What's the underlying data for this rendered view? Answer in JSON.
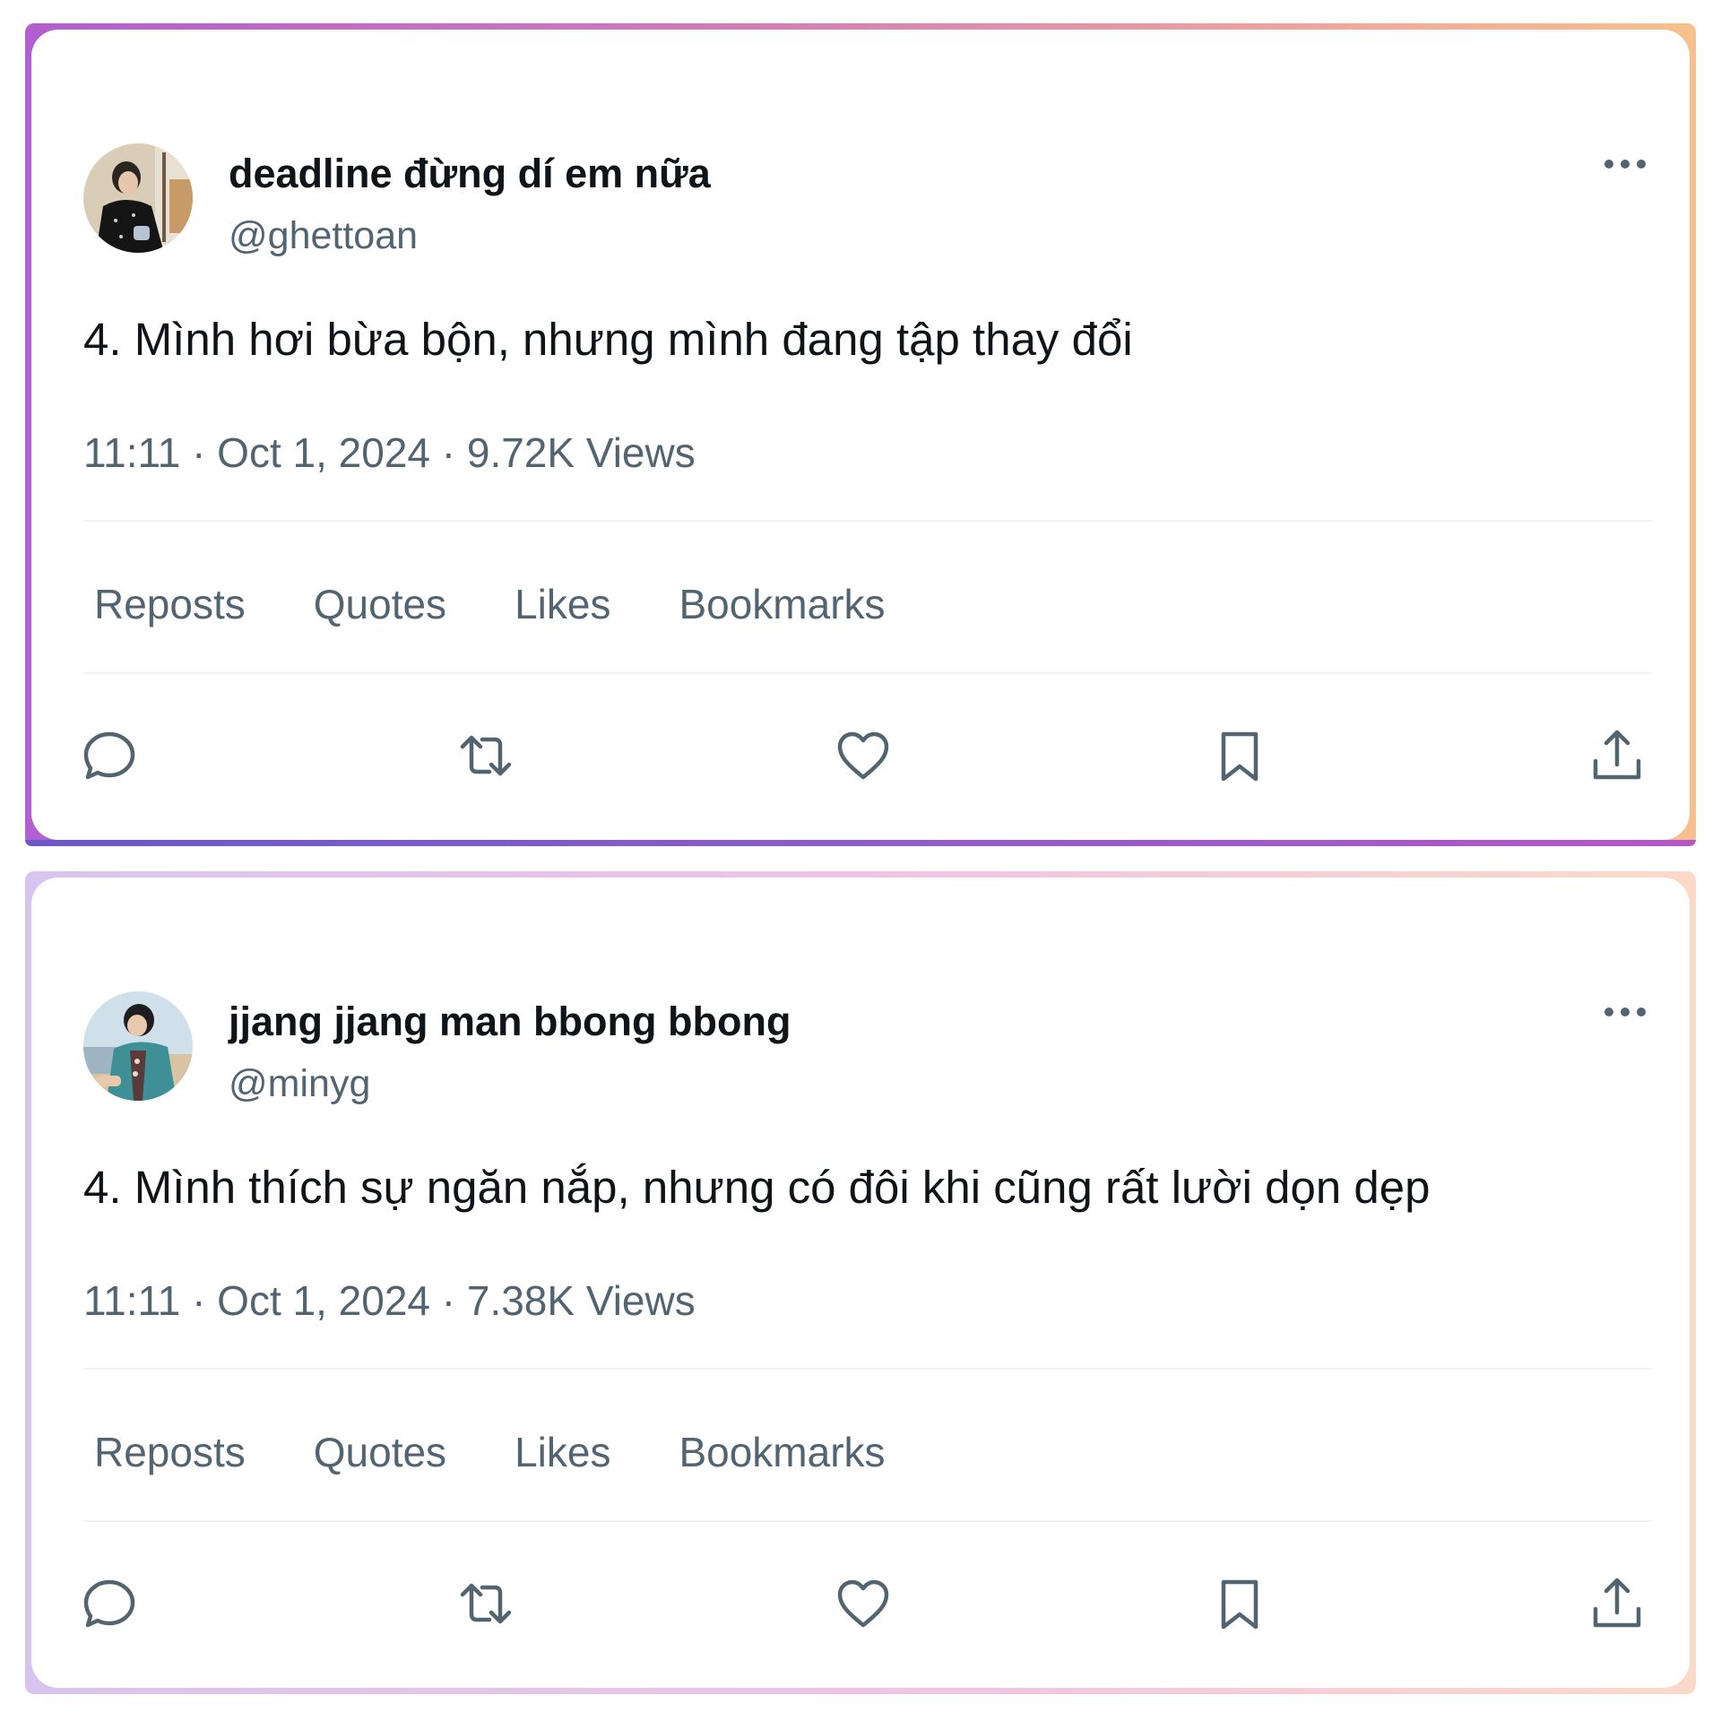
{
  "posts": [
    {
      "display_name": "deadline đừng dí em nữa",
      "handle": "@ghettoan",
      "text": "4. Mình hơi bừa bộn, nhưng mình đang tập thay đổi",
      "meta": "11:11 · Oct 1, 2024 · 9.72K Views",
      "stats": [
        "Reposts",
        "Quotes",
        "Likes",
        "Bookmarks"
      ]
    },
    {
      "display_name": "jjang jjang man bbong bbong",
      "handle": "@minyg",
      "text": "4. Mình thích sự ngăn nắp, nhưng có đôi khi cũng rất lười dọn dẹp",
      "meta": "11:11 · Oct 1, 2024 · 7.38K Views",
      "stats": [
        "Reposts",
        "Quotes",
        "Likes",
        "Bookmarks"
      ]
    }
  ],
  "icons": {
    "more": "more-horizontal-icon",
    "reply": "reply-icon",
    "repost": "repost-icon",
    "like": "heart-icon",
    "bookmark": "bookmark-icon",
    "share": "share-icon"
  },
  "colors": {
    "text_primary": "#0f1419",
    "text_secondary": "#536471",
    "divider": "#eff3f4"
  }
}
